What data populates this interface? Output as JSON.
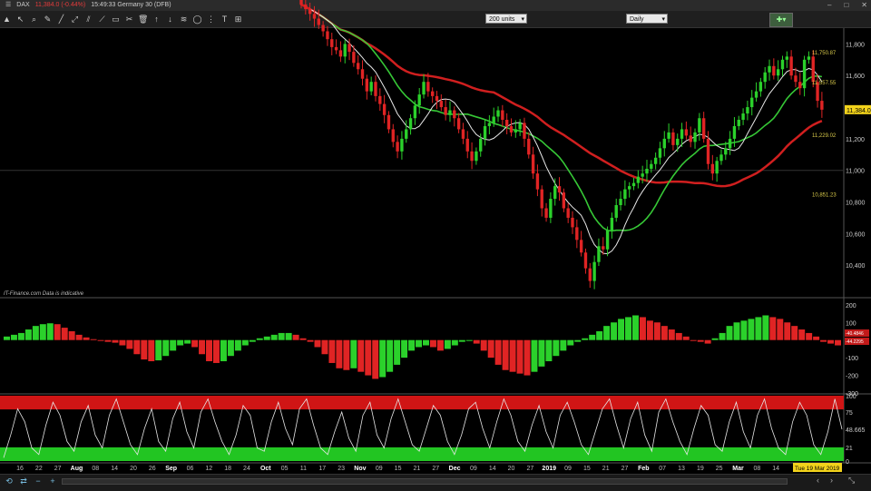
{
  "titlebar": {
    "symbol": "DAX",
    "price": "11,384.0 (-0.44%)",
    "time_instrument": "15:49:33 Germany 30 (DFB)"
  },
  "toolbar": {
    "units_select": "200 units",
    "period_select": "Daily"
  },
  "watermark": "IT-Finance.com Data is indicative",
  "colors": {
    "up": "#2bd12b",
    "down": "#e02424",
    "ma_red": "#d01f1f",
    "ma_green": "#36c836",
    "ma_white": "#e8e8e8",
    "band_red": "#d01515",
    "band_green": "#22c522"
  },
  "chart_data": [
    {
      "type": "candlestick",
      "title": "",
      "ylim": [
        10200,
        11900
      ],
      "y_ticks": [
        "11,800",
        "11,600",
        "11,400",
        "11,200",
        "11,000",
        "10,800",
        "10,600",
        "10,400"
      ],
      "price_labels": [
        {
          "text": "11,750.87",
          "value": 11750
        },
        {
          "text": "11,557.55",
          "value": 11560
        },
        {
          "text": "11,384.0",
          "value": 11384
        },
        {
          "text": "11,229.02",
          "value": 11229
        },
        {
          "text": "10,851.23",
          "value": 10851
        }
      ],
      "current_price": 11384,
      "closes": [
        12050,
        12020,
        11990,
        11960,
        11920,
        11880,
        11830,
        11780,
        11760,
        11720,
        11800,
        11750,
        11680,
        11640,
        11580,
        11500,
        11560,
        11470,
        11420,
        11350,
        11260,
        11180,
        11120,
        11200,
        11260,
        11330,
        11410,
        11480,
        11560,
        11500,
        11470,
        11440,
        11400,
        11350,
        11380,
        11330,
        11260,
        11200,
        11120,
        11060,
        11120,
        11200,
        11280,
        11300,
        11340,
        11380,
        11320,
        11280,
        11240,
        11260,
        11300,
        11200,
        11100,
        10980,
        10880,
        10760,
        10700,
        10820,
        10900,
        10860,
        10760,
        10700,
        10640,
        10560,
        10480,
        10380,
        10300,
        10420,
        10520,
        10500,
        10620,
        10700,
        10780,
        10820,
        10880,
        10900,
        10920,
        10960,
        10980,
        11010,
        11040,
        11080,
        11140,
        11200,
        11240,
        11160,
        11200,
        11260,
        11220,
        11180,
        11240,
        11330,
        11200,
        11040,
        10980,
        11060,
        11100,
        11140,
        11200,
        11280,
        11320,
        11360,
        11400,
        11460,
        11500,
        11560,
        11620,
        11660,
        11600,
        11640,
        11700,
        11720,
        11600,
        11560,
        11520,
        11700,
        11720,
        11560,
        11440,
        11384
      ],
      "moving_averages": [
        {
          "name": "",
          "color": "#d01f1f",
          "start": 12150,
          "end": 11500
        },
        {
          "name": "",
          "color": "#36c836",
          "end": 11400
        },
        {
          "name": "",
          "color": "#e8e8e8",
          "end": 11540
        }
      ]
    },
    {
      "type": "bar",
      "title": "",
      "ylim": [
        -300,
        230
      ],
      "y_ticks": [
        "200",
        "100",
        "0",
        "-100",
        "-200",
        "-300"
      ],
      "values": [
        20,
        30,
        40,
        60,
        80,
        90,
        95,
        90,
        70,
        50,
        30,
        15,
        5,
        -5,
        -10,
        -15,
        -30,
        -50,
        -80,
        -110,
        -120,
        -115,
        -90,
        -60,
        -30,
        -20,
        -40,
        -80,
        -120,
        -130,
        -120,
        -90,
        -60,
        -30,
        -10,
        10,
        20,
        30,
        40,
        40,
        30,
        10,
        -10,
        -40,
        -80,
        -130,
        -160,
        -170,
        -160,
        -180,
        -200,
        -220,
        -210,
        -180,
        -140,
        -100,
        -60,
        -40,
        -30,
        -40,
        -60,
        -50,
        -30,
        -10,
        -5,
        -20,
        -60,
        -100,
        -140,
        -170,
        -180,
        -190,
        -200,
        -180,
        -150,
        -120,
        -90,
        -60,
        -30,
        -10,
        10,
        30,
        50,
        80,
        100,
        120,
        130,
        140,
        130,
        110,
        100,
        80,
        60,
        40,
        20,
        0,
        -10,
        -20,
        10,
        40,
        80,
        100,
        110,
        120,
        130,
        140,
        130,
        120,
        100,
        80,
        60,
        40,
        20,
        -10,
        -20,
        -30
      ],
      "labels": [
        "-40.4846",
        "-44.2295"
      ]
    },
    {
      "type": "line",
      "title": "",
      "ylim": [
        0,
        100
      ],
      "y_ticks": [
        "100",
        "75",
        "48.665",
        "21",
        "0"
      ],
      "overbought": 79,
      "oversold": 21,
      "values": [
        5,
        40,
        80,
        60,
        20,
        10,
        55,
        90,
        70,
        30,
        15,
        60,
        85,
        40,
        20,
        70,
        95,
        60,
        25,
        10,
        50,
        80,
        30,
        15,
        65,
        90,
        45,
        20,
        75,
        95,
        60,
        30,
        10,
        40,
        85,
        70,
        20,
        15,
        60,
        90,
        50,
        25,
        80,
        95,
        55,
        20,
        10,
        45,
        75,
        35,
        15,
        70,
        90,
        40,
        20,
        65,
        95,
        60,
        25,
        15,
        50,
        85,
        70,
        30,
        10,
        40,
        80,
        90,
        50,
        20,
        60,
        95,
        70,
        30,
        15,
        55,
        85,
        45,
        20,
        70,
        90,
        60,
        25,
        10,
        45,
        80,
        95,
        55,
        20,
        65,
        90,
        40,
        15,
        75,
        95,
        60,
        30,
        10,
        50,
        85,
        70,
        25,
        15,
        60,
        90,
        45,
        20,
        70,
        95,
        50,
        20,
        10,
        60,
        90,
        70,
        25,
        10,
        45,
        95,
        48.665
      ]
    }
  ],
  "x_axis_labels": [
    "16",
    "22",
    "27",
    "Aug",
    "08",
    "14",
    "20",
    "26",
    "Sep",
    "06",
    "12",
    "18",
    "24",
    "Oct",
    "05",
    "11",
    "17",
    "23",
    "Nov",
    "09",
    "15",
    "21",
    "27",
    "Dec",
    "09",
    "14",
    "20",
    "27",
    "2019",
    "09",
    "15",
    "21",
    "27",
    "Feb",
    "07",
    "13",
    "19",
    "25",
    "Mar",
    "08",
    "14",
    "Tue 19 Mar 2019"
  ]
}
